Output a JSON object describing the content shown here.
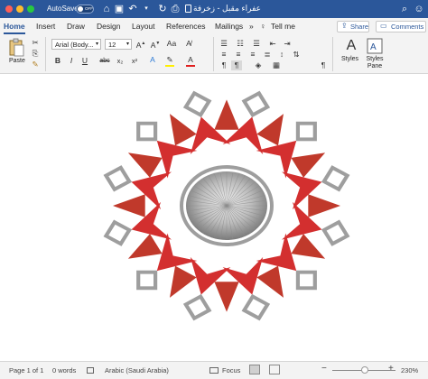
{
  "titlebar": {
    "autosave_label": "AutoSave",
    "autosave_state": "OFF",
    "document_title": "عفراء مقبل - زخرفة",
    "bg_color": "#2b579a"
  },
  "tabs": {
    "items": [
      "Home",
      "Insert",
      "Draw",
      "Design",
      "Layout",
      "References",
      "Mailings"
    ],
    "more": "»",
    "tell_me": "Tell me",
    "share": "Share",
    "comments": "Comments"
  },
  "ribbon": {
    "paste_label": "Paste",
    "font_name": "Arial (Body...",
    "font_size": "12",
    "styles_label": "Styles",
    "styles_pane_label": "Styles Pane",
    "format_buttons": [
      "B",
      "I",
      "U",
      "abc",
      "x₂",
      "x²"
    ]
  },
  "document": {
    "ornament_colors": [
      "#d32f2f",
      "#c0392b",
      "#9e9e9e"
    ]
  },
  "status": {
    "page": "Page 1 of 1",
    "words": "0 words",
    "language": "Arabic (Saudi Arabia)",
    "focus": "Focus",
    "zoom": "230%"
  }
}
